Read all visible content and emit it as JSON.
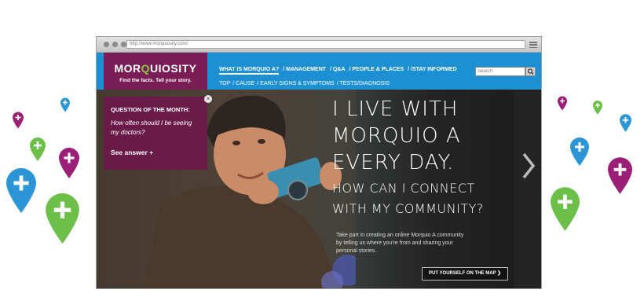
{
  "browser": {
    "url": "http://www.morquiosity.com/"
  },
  "site": {
    "logo": {
      "brand_prefix": "MOR",
      "brand_q": "Q",
      "brand_suffix": "UIOSITY",
      "tagline": "Find the facts. Tell your story."
    },
    "main_nav": [
      {
        "label": "WHAT IS MORQUIO A?"
      },
      {
        "label": "/ MANAGEMENT"
      },
      {
        "label": "/ Q&A"
      },
      {
        "label": "/ PEOPLE & PLACES"
      },
      {
        "label": "/ /STAY INFORMED"
      }
    ],
    "sub_nav": [
      {
        "label": "TOP"
      },
      {
        "label": "/ CAUSE"
      },
      {
        "label": "/ EARLY SIGNS & SYMPTOMS"
      },
      {
        "label": "/ TESTS/DIAGNOSIS"
      }
    ],
    "search": {
      "placeholder": "Search"
    }
  },
  "question": {
    "title": "QUESTION OF THE MONTH:",
    "text": "How often should I be seeing my doctors?",
    "answer_link": "See answer +",
    "close": "×"
  },
  "hero": {
    "headline_1": "I LIVE WITH",
    "headline_2": "MORQUIO A",
    "headline_3": "EVERY DAY.",
    "sub_1": "HOW CAN I CONNECT",
    "sub_2": "WITH MY COMMUNITY?",
    "body": "Take part in creating an online Morquio A community by telling us where you're from and sharing your personal stories.",
    "cta": "PUT YOURSELF ON THE MAP  ❯",
    "next_arrow": "❯"
  },
  "colors": {
    "pin_blue": "#2c95d6",
    "pin_green": "#6cc04a",
    "pin_purple": "#9b1f77",
    "nav_blue": "#1d8fd3",
    "logo_purple": "#7a1d56"
  }
}
